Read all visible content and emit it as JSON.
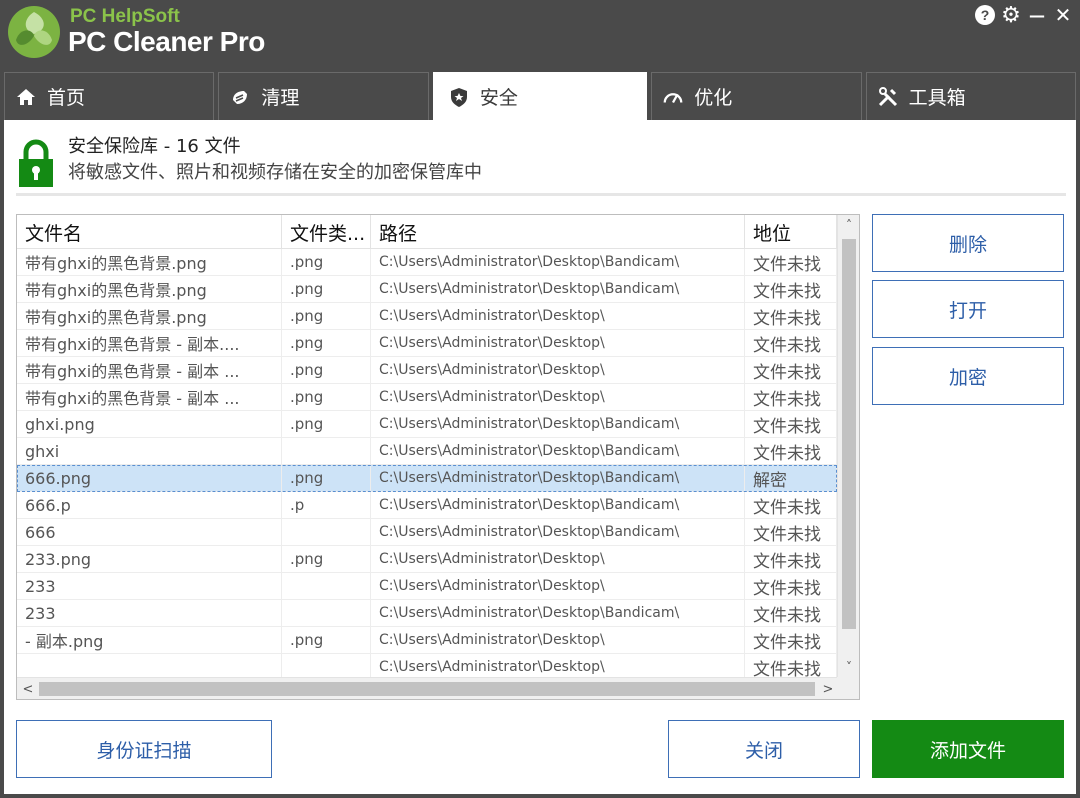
{
  "app": {
    "brand_small": "PC HelpSoft",
    "brand_title": "PC Cleaner Pro"
  },
  "window_controls": {
    "help": "?",
    "settings": "⚙",
    "minimize": "—",
    "close": "✕"
  },
  "tabs": [
    {
      "label": "首页",
      "icon": "home-icon"
    },
    {
      "label": "清理",
      "icon": "broom-icon"
    },
    {
      "label": "安全",
      "icon": "shield-icon",
      "active": true
    },
    {
      "label": "优化",
      "icon": "speedometer-icon"
    },
    {
      "label": "工具箱",
      "icon": "tools-icon"
    }
  ],
  "vault": {
    "title": "安全保险库 - 16 文件",
    "description": "将敏感文件、照片和视频存储在安全的加密保管库中",
    "icon": "lock-icon",
    "accent_color": "#148a14"
  },
  "table": {
    "columns": [
      "文件名",
      "文件类...",
      "路径",
      "地位"
    ],
    "rows": [
      {
        "name": "带有ghxi的黑色背景.png",
        "type": ".png",
        "path": "C:\\Users\\Administrator\\Desktop\\Bandicam\\",
        "status": "文件未找"
      },
      {
        "name": "带有ghxi的黑色背景.png",
        "type": ".png",
        "path": "C:\\Users\\Administrator\\Desktop\\Bandicam\\",
        "status": "文件未找"
      },
      {
        "name": "带有ghxi的黑色背景.png",
        "type": ".png",
        "path": "C:\\Users\\Administrator\\Desktop\\",
        "status": "文件未找"
      },
      {
        "name": "带有ghxi的黑色背景 - 副本....",
        "type": ".png",
        "path": "C:\\Users\\Administrator\\Desktop\\",
        "status": "文件未找"
      },
      {
        "name": "带有ghxi的黑色背景 - 副本 ...",
        "type": ".png",
        "path": "C:\\Users\\Administrator\\Desktop\\",
        "status": "文件未找"
      },
      {
        "name": "带有ghxi的黑色背景 - 副本 ...",
        "type": ".png",
        "path": "C:\\Users\\Administrator\\Desktop\\",
        "status": "文件未找"
      },
      {
        "name": "ghxi.png",
        "type": ".png",
        "path": "C:\\Users\\Administrator\\Desktop\\Bandicam\\",
        "status": "文件未找"
      },
      {
        "name": "ghxi",
        "type": "",
        "path": "C:\\Users\\Administrator\\Desktop\\Bandicam\\",
        "status": "文件未找"
      },
      {
        "name": "666.png",
        "type": ".png",
        "path": "C:\\Users\\Administrator\\Desktop\\Bandicam\\",
        "status": "解密",
        "selected": true
      },
      {
        "name": "666.p",
        "type": ".p",
        "path": "C:\\Users\\Administrator\\Desktop\\Bandicam\\",
        "status": "文件未找"
      },
      {
        "name": "666",
        "type": "",
        "path": "C:\\Users\\Administrator\\Desktop\\Bandicam\\",
        "status": "文件未找"
      },
      {
        "name": "233.png",
        "type": ".png",
        "path": "C:\\Users\\Administrator\\Desktop\\",
        "status": "文件未找"
      },
      {
        "name": "233",
        "type": "",
        "path": "C:\\Users\\Administrator\\Desktop\\",
        "status": "文件未找"
      },
      {
        "name": "233",
        "type": "",
        "path": "C:\\Users\\Administrator\\Desktop\\Bandicam\\",
        "status": "文件未找"
      },
      {
        "name": "- 副本.png",
        "type": ".png",
        "path": "C:\\Users\\Administrator\\Desktop\\",
        "status": "文件未找"
      },
      {
        "name": "",
        "type": "",
        "path": "C:\\Users\\Administrator\\Desktop\\",
        "status": "文件未找"
      }
    ]
  },
  "side_buttons": {
    "delete": "删除",
    "open": "打开",
    "encrypt": "加密"
  },
  "bottom_buttons": {
    "id_scan": "身份证扫描",
    "close": "关闭",
    "add_file": "添加文件"
  },
  "scroll": {
    "up": "˄",
    "down": "˅",
    "left": "<",
    "right": ">"
  }
}
